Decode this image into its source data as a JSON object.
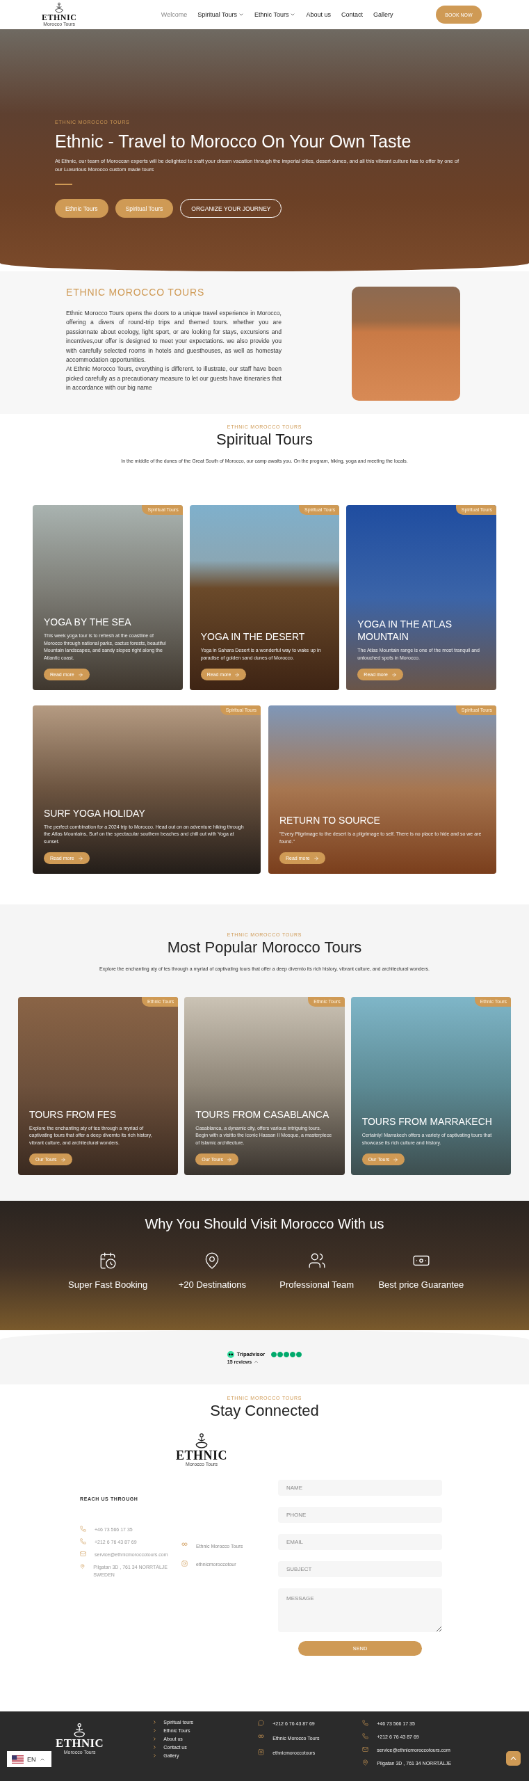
{
  "header": {
    "logo": {
      "name": "ETHNIC",
      "tagline": "Morocco Tours"
    },
    "nav": [
      {
        "label": "Welcome",
        "selected": true,
        "dropdown": false
      },
      {
        "label": "Spiritual Tours",
        "selected": false,
        "dropdown": true
      },
      {
        "label": "Ethnic Tours",
        "selected": false,
        "dropdown": true
      },
      {
        "label": "About us",
        "selected": false,
        "dropdown": false
      },
      {
        "label": "Contact",
        "selected": false,
        "dropdown": false
      },
      {
        "label": "Gallery",
        "selected": false,
        "dropdown": false
      }
    ],
    "cta": "BOOK NOW"
  },
  "hero": {
    "eyebrow": "ETHNIC MOROCCO TOURS",
    "title": "Ethnic - Travel to Morocco On Your Own Taste",
    "text": "At Ethnic, our team of Moroccan experts will be delighted to craft your dream vacation through the imperial cities, desert dunes, and all this vibrant culture has to offer by one of our Luxurious Morocco custom made tours",
    "buttons": [
      {
        "label": "Ethnic Tours",
        "kind": "filled"
      },
      {
        "label": "Spiritual Tours",
        "kind": "filled"
      },
      {
        "label": "ORGANIZE YOUR JOURNEY",
        "kind": "outline"
      }
    ]
  },
  "about": {
    "heading": "ETHNIC MOROCCO TOURS",
    "paragraphs": [
      "Ethnic Morocco Tours opens the doors to a unique travel experience in Morocco, offering a divers of round-trip trips and themed tours. whether you are passionnate about ecology, light sport, or are looking for stays, excursions and incentives,our offer is designed to meet your expectations. we also provide you with carefully selected rooms in hotels and guesthouses, as well as homestay accommodation opportunities.",
      "At Ethnic Morocco Tours, everything is different. to illustrate, our staff have been picked carefully as a precautionary measure to let our guests have itineraries that in accordance with our big name"
    ]
  },
  "spiritual": {
    "eyebrow": "ETHNIC MOROCCO TOURS",
    "title": "Spiritual Tours",
    "text": "In the middle of the dunes of the Great South of Morocco, our camp awaits you. On the program, hiking, yoga and meeting the locals.",
    "cards": [
      {
        "badge": "Spiritual Tours",
        "title": "YOGA BY THE SEA",
        "text": "This week yoga tour is to refresh at the coastline of Morocco through national parks, cactus forests, beautiful Mountain landscapes, and sandy slopes right along the Atlantic coast.",
        "button": "Read more"
      },
      {
        "badge": "Spiritual Tours",
        "title": "YOGA IN THE DESERT",
        "text": "Yoga in Sahara Desert is a wonderful way to wake up in paradise of golden sand dunes of Morocco.",
        "button": "Read more"
      },
      {
        "badge": "Spiritual Tours",
        "title": "YOGA IN THE ATLAS MOUNTAIN",
        "text": "The Atlas Mountain range is one of the most tranquil and untouched spots in Morocco.",
        "button": "Read more"
      },
      {
        "badge": "Spiritual Tours",
        "title": "SURF YOGA HOLIDAY",
        "text": "The perfect combination for a 2024 trip to Morocco.  Head out on an adventure hiking through the Atlas Mountains, Surf on the spectacular southern beaches and chill out with Yoga at sunset.",
        "button": "Read more"
      },
      {
        "badge": "Spiritual Tours",
        "title": "RETURN TO SOURCE",
        "text": "\"Every Pilgrimage to the desert is a pilgrimage to self.  There is no place to hide and so we are found.\"",
        "button": "Read more"
      }
    ]
  },
  "popular": {
    "eyebrow": "ETHNIC MOROCCO TOURS",
    "title": "Most Popular Morocco Tours",
    "text": "Explore the enchanting aty of tes through a myriad of captivating tours that offer a deep divernto its rich history, vibrant culture, and architectural wonders.",
    "cards": [
      {
        "badge": "Ethnic Tours",
        "title": "TOURS FROM FES",
        "text": "Explore the enchanting aty of tes through a myriad of captivating tours that offer a deep divernto its rich history, vibrant culture, and architectural wonders.",
        "button": "Our Tours"
      },
      {
        "badge": "Ethnic Tours",
        "title": "TOURS FROM CASABLANCA",
        "text": "Casablanca, a dynamic city, offers various intriguing tours. Begin with a visitto the iconic Hassan II Mosque, a masterpiece of Islamic architecture.",
        "button": "Our Tours"
      },
      {
        "badge": "Ethnic Tours",
        "title": "TOURS FROM MARRAKECH",
        "text": "Certainly! Marrakech offers a variety of captivating tours that showcase its rich culture and history.",
        "button": "Our Tours"
      }
    ]
  },
  "why": {
    "title": "Why You Should Visit Morocco With us",
    "features": [
      {
        "kind": "calendar",
        "label": "Super Fast Booking"
      },
      {
        "kind": "pin",
        "label": "+20 Destinations"
      },
      {
        "kind": "team",
        "label": "Professional Team"
      },
      {
        "kind": "money",
        "label": "Best price Guarantee"
      }
    ]
  },
  "tripadvisor": {
    "brand": "Tripadvisor",
    "stars": 5,
    "reviews": "15 reviews"
  },
  "contact": {
    "eyebrow": "ETHNIC MOROCCO TOURS",
    "title": "Stay Connected",
    "logo": {
      "name": "ETHNIC",
      "tagline": "Morocco Tours"
    },
    "reach_title": "REACH US THROUGH",
    "details": [
      {
        "kind": "phone",
        "text": "+46 73 566 17 35"
      },
      {
        "kind": "phone",
        "text": "+212 6 76 43 87 69"
      },
      {
        "kind": "email",
        "text": "service@ethnicmoroccotours.com"
      },
      {
        "kind": "location",
        "text": "Pilgatan 3D , 761 34 NORRTÄLJE SWEDEN"
      }
    ],
    "social": [
      {
        "kind": "tripadvisor",
        "text": "Ethnic Morocco Tours"
      },
      {
        "kind": "instagram",
        "text": "ethnicmoroccotour"
      }
    ],
    "fields": [
      {
        "placeholder": "NAME"
      },
      {
        "placeholder": "PHONE"
      },
      {
        "placeholder": "EMAIL"
      },
      {
        "placeholder": "SUBJECT"
      }
    ],
    "message": {
      "placeholder": "MESSAGE"
    },
    "submit": "SEND"
  },
  "footer": {
    "logo": {
      "name": "ETHNIC",
      "tagline": "Morocco Tours"
    },
    "links": [
      "Spiritual tours",
      "Ethnic Tours",
      "About us",
      "Contact us",
      "Gallery"
    ],
    "social": [
      {
        "kind": "whatsapp",
        "text": "+212 6 76 43 87 69"
      },
      {
        "kind": "tripadvisor",
        "text": "Ethnic Morocco Tours"
      },
      {
        "kind": "instagram",
        "text": "ethnicmoroccotours"
      }
    ],
    "contact": [
      {
        "kind": "phone",
        "text": "+46 73 566 17 35"
      },
      {
        "kind": "phone",
        "text": "+212 6 76 43 87 69"
      },
      {
        "kind": "email",
        "text": "service@ethnicmoroccotours.com"
      },
      {
        "kind": "location",
        "text": "Pilgatan 3D , 761 34 NORRTÄLJE"
      }
    ]
  },
  "language": {
    "code": "EN"
  }
}
